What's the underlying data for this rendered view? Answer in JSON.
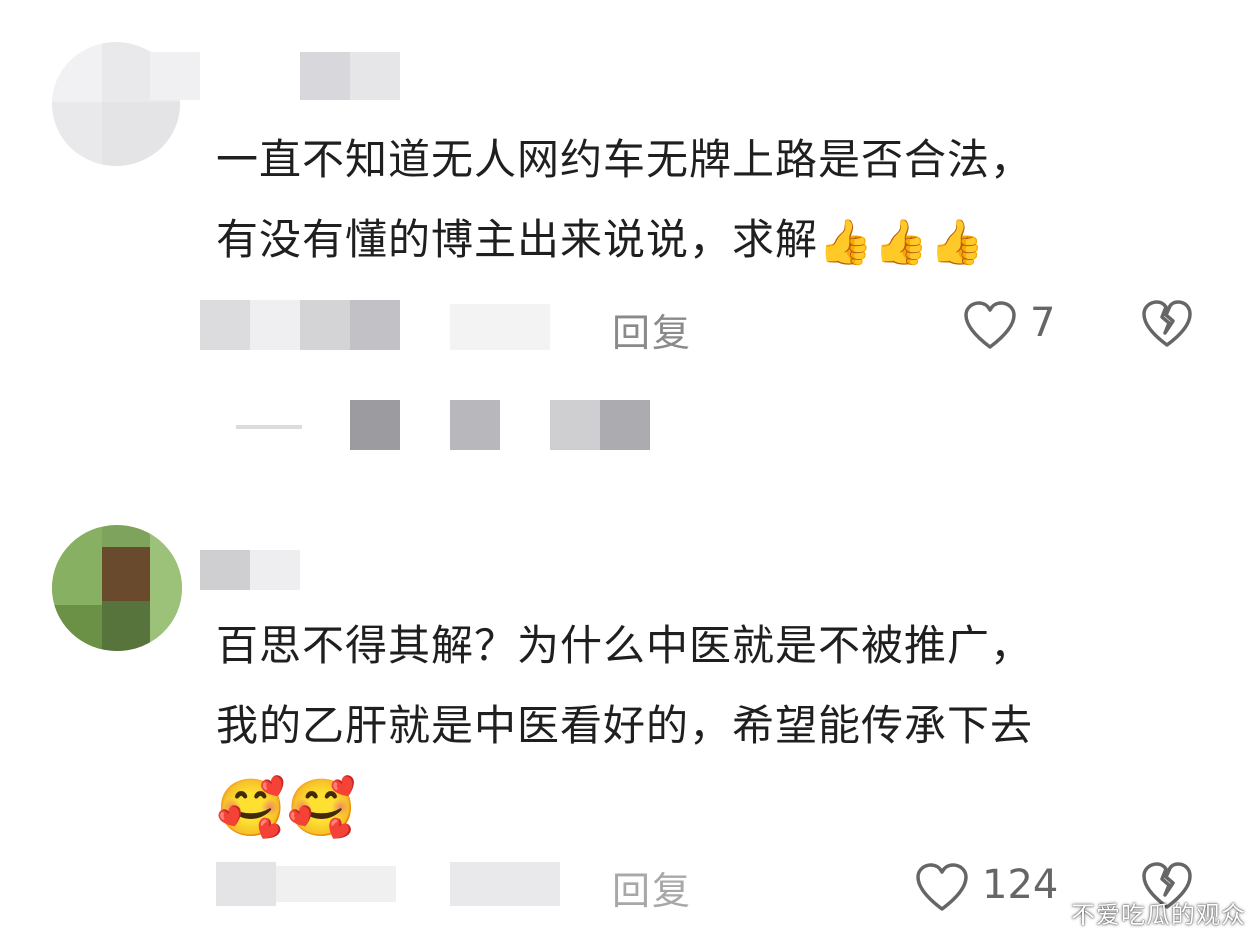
{
  "comments": [
    {
      "line1": "一直不知道无人网约车无牌上路是否合法，",
      "line2": "有没有懂的博主出来说说，求解",
      "emojis": [
        "👍",
        "👍",
        "👍"
      ],
      "reply_label": "回复",
      "like_count": "7"
    },
    {
      "line1": "百思不得其解？为什么中医就是不被推广，",
      "line2": "我的乙肝就是中医看好的，希望能传承下去",
      "emojis": [
        "🥰",
        "🥰"
      ],
      "reply_label": "回复",
      "like_count": "124"
    }
  ],
  "watermark": "不爱吃瓜的观众",
  "icons": {
    "like": "heart-outline-icon",
    "dislike": "broken-heart-icon"
  },
  "colors": {
    "text": "#1f1f1f",
    "muted": "#8a8a8a",
    "icon": "#666666"
  }
}
